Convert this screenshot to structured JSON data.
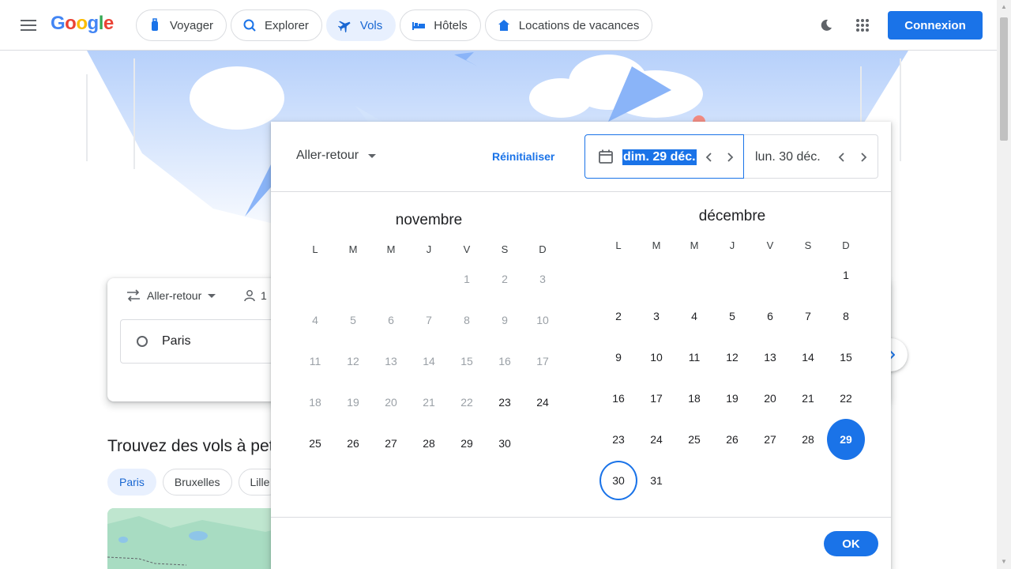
{
  "header": {
    "logo": "Google",
    "nav": [
      "Voyager",
      "Explorer",
      "Vols",
      "Hôtels",
      "Locations de vacances"
    ],
    "signin": "Connexion"
  },
  "search": {
    "trip_type": "Aller-retour",
    "passengers": "1",
    "origin": "Paris"
  },
  "explore": {
    "title": "Trouvez des vols à peti",
    "cities": [
      "Paris",
      "Bruxelles",
      "Lille"
    ]
  },
  "picker": {
    "trip_type": "Aller-retour",
    "reset": "Réinitialiser",
    "depart": "dim. 29 déc.",
    "return": "lun. 30 déc.",
    "ok": "OK",
    "dow": [
      "L",
      "M",
      "M",
      "J",
      "V",
      "S",
      "D"
    ],
    "months": [
      {
        "name": "novembre",
        "weeks": [
          [
            "",
            "",
            "",
            "",
            "1",
            "2",
            "3"
          ],
          [
            "4",
            "5",
            "6",
            "7",
            "8",
            "9",
            "10"
          ],
          [
            "11",
            "12",
            "13",
            "14",
            "15",
            "16",
            "17"
          ],
          [
            "18",
            "19",
            "20",
            "21",
            "22",
            "23",
            "24"
          ],
          [
            "25",
            "26",
            "27",
            "28",
            "29",
            "30",
            ""
          ]
        ],
        "past_until": 22
      },
      {
        "name": "décembre",
        "weeks": [
          [
            "",
            "",
            "",
            "",
            "",
            "",
            "1"
          ],
          [
            "2",
            "3",
            "4",
            "5",
            "6",
            "7",
            "8"
          ],
          [
            "9",
            "10",
            "11",
            "12",
            "13",
            "14",
            "15"
          ],
          [
            "16",
            "17",
            "18",
            "19",
            "20",
            "21",
            "22"
          ],
          [
            "23",
            "24",
            "25",
            "26",
            "27",
            "28",
            "29"
          ],
          [
            "30",
            "31",
            "",
            "",
            "",
            "",
            ""
          ]
        ],
        "selected": "29",
        "return_day": "30"
      }
    ]
  },
  "colors": {
    "accent": "#1a73e8",
    "accent_light": "#e8f0fe",
    "past_text": "#9aa0a6"
  }
}
